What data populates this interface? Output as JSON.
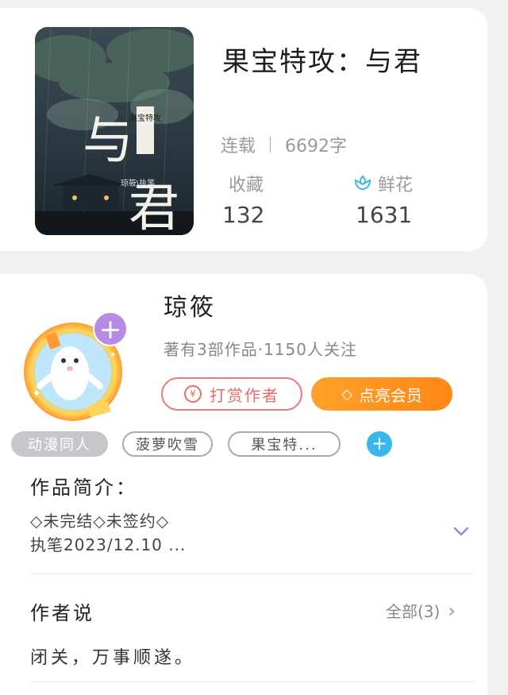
{
  "book": {
    "title": "果宝特攻：与君",
    "status": "连载",
    "word_count": "6692字",
    "collect_label": "收藏",
    "collect_value": "132",
    "flower_label": "鲜花",
    "flower_value": "1631",
    "cover_title": "与君",
    "cover_series": "果宝特攻",
    "cover_author": "琼筱\\执笔"
  },
  "author": {
    "name": "琼筱",
    "meta": "著有3部作品·1150人关注",
    "tip_label": "打赏作者",
    "vip_label": "点亮会员"
  },
  "tags": [
    "动漫同人",
    "菠萝吹雪",
    "果宝特..."
  ],
  "intro": {
    "title": "作品简介：",
    "line1": "◇未完结◇未签约◇",
    "line2": "执笔2023/12.10 ..."
  },
  "author_says": {
    "title": "作者说",
    "see_all": "全部(3)",
    "text": "闭关，万事顺遂。"
  },
  "colors": {
    "accent_purple": "#b78ae6",
    "tip_red": "#e86b6b",
    "vip_orange": "#ff8716",
    "add_blue": "#3ab6ef"
  }
}
